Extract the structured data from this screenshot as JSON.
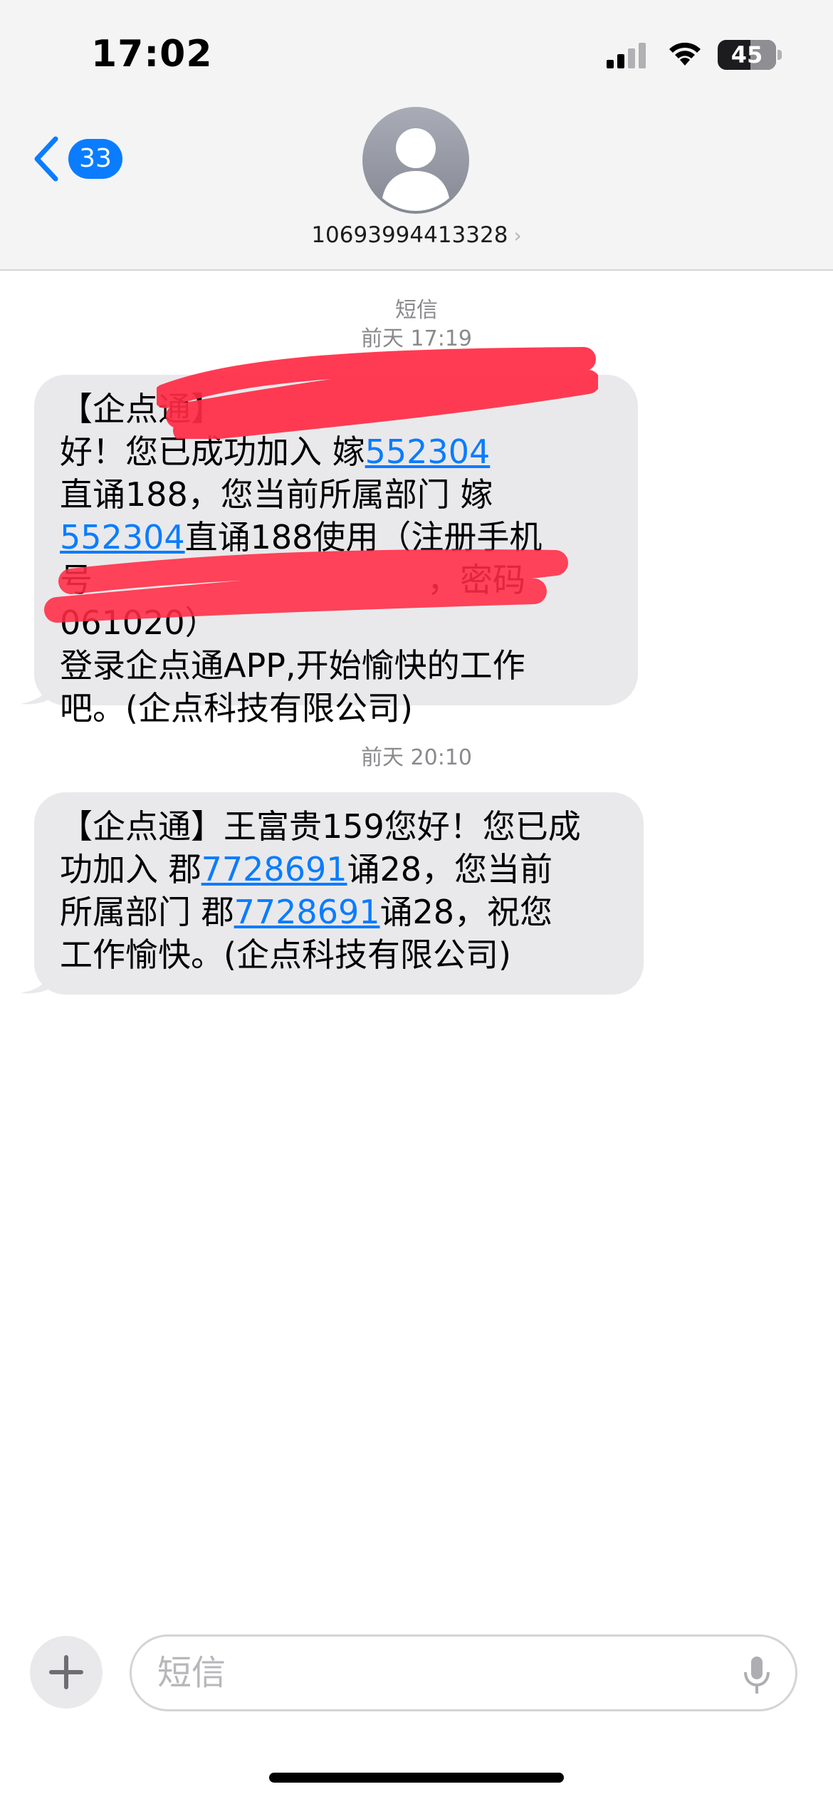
{
  "status_bar": {
    "time": "17:02",
    "battery": "45"
  },
  "header": {
    "back_badge": "33",
    "contact_number": "10693994413328",
    "chevron": "›"
  },
  "thread": {
    "service_label": "短信",
    "messages": [
      {
        "timestamp": "前天 17:19",
        "lines": [
          "【企点通】",
          "好！您已成功加入 嫁",
          "552304",
          "直诵188，您当前所属部门 嫁",
          "552304",
          "直诵188使用（注册手机",
          "号",
          "，密码 061020）",
          "登录企点通APP,开始愉快的工作",
          "吧。(企点科技有限公司)"
        ]
      },
      {
        "timestamp": "前天 20:10",
        "lines": [
          "【企点通】王富贵159您好！您已成",
          "功加入 郡",
          "7728691",
          "诵28，您当前",
          "所属部门 郡",
          "7728691",
          "诵28，祝您",
          "工作愉快。(企点科技有限公司)"
        ]
      }
    ]
  },
  "composer": {
    "placeholder": "短信",
    "plus_label": "+"
  },
  "colors": {
    "link": "#0a7cff",
    "bubble": "#e9e9eb",
    "header_bg": "#f4f4f5",
    "badge": "#0a7cff",
    "redaction": "#ff2a44"
  },
  "icons": [
    "back-chevron-icon",
    "person-icon",
    "signal-icon",
    "wifi-icon",
    "battery-icon",
    "plus-icon",
    "microphone-icon"
  ]
}
